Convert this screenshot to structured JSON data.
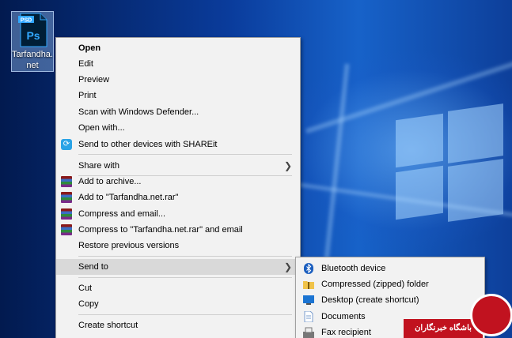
{
  "desktop": {
    "file_icon_badge": "PSD",
    "file_icon_app": "Ps",
    "file_label": "Tarfandha.net"
  },
  "context_menu": {
    "items": [
      {
        "label": "Open",
        "bold": true
      },
      {
        "label": "Edit"
      },
      {
        "label": "Preview"
      },
      {
        "label": "Print"
      },
      {
        "label": "Scan with Windows Defender..."
      },
      {
        "label": "Open with..."
      },
      {
        "label": "Send to other devices with SHAREit",
        "icon": "shareit-icon"
      },
      {
        "label": "Share with",
        "icon": "chevron-right-icon"
      },
      {
        "label": "Add to archive...",
        "icon": "winrar-icon"
      },
      {
        "label": "Add to \"Tarfandha.net.rar\"",
        "icon": "winrar-icon"
      },
      {
        "label": "Compress and email...",
        "icon": "winrar-icon"
      },
      {
        "label": "Compress to \"Tarfandha.net.rar\" and email",
        "icon": "winrar-icon"
      },
      {
        "label": "Restore previous versions"
      },
      {
        "label": "Send to",
        "highlighted": true,
        "icon": "chevron-right-icon"
      },
      {
        "label": "Cut"
      },
      {
        "label": "Copy"
      },
      {
        "label": "Create shortcut"
      }
    ]
  },
  "send_to_menu": {
    "items": [
      {
        "label": "Bluetooth device",
        "icon": "bluetooth-icon"
      },
      {
        "label": "Compressed (zipped) folder",
        "icon": "zip-folder-icon"
      },
      {
        "label": "Desktop (create shortcut)",
        "icon": "desktop-icon"
      },
      {
        "label": "Documents",
        "icon": "documents-icon"
      },
      {
        "label": "Fax recipient",
        "icon": "fax-icon"
      }
    ]
  },
  "watermark": {
    "text": "باشگاه خبرنگاران"
  },
  "colors": {
    "menu_bg": "#f2f2f2",
    "highlight": "#d9d9d9",
    "ps_blue": "#31a8ff",
    "ps_dark": "#001e36",
    "watermark_red": "#c1121f"
  }
}
